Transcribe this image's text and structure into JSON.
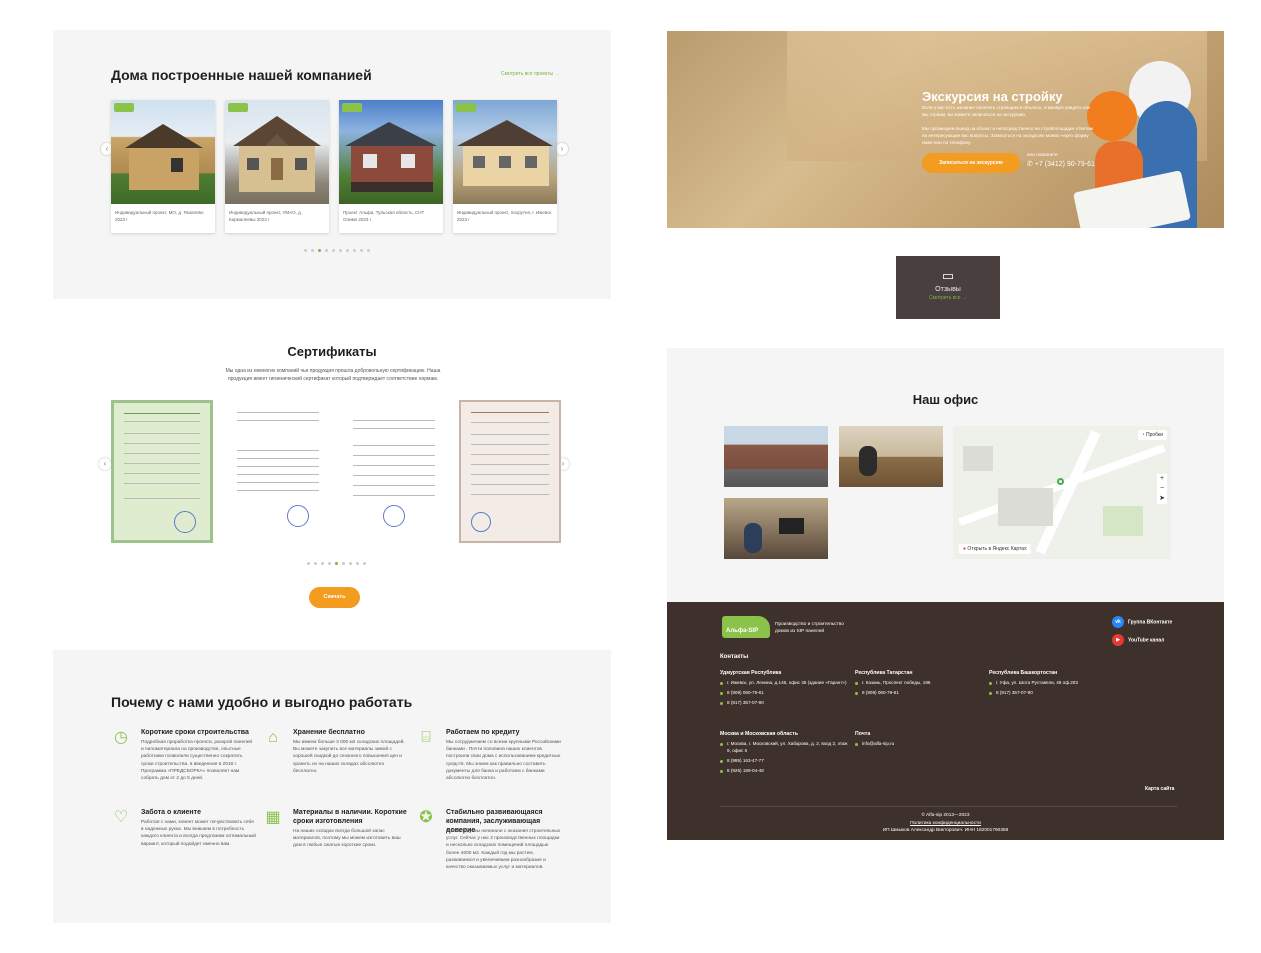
{
  "houses": {
    "title": "Дома построенные нашей компанией",
    "see_all": "Смотреть все проекты →",
    "cards": [
      {
        "caption": "Индивидуальный проект, МО, д. Яковлево 2023 г"
      },
      {
        "caption": "Индивидуальный проект, УМАО, д. Кармалеевы 2023 г"
      },
      {
        "caption": "Проект Альфа, Тульская область, СНТ Олимп 2023 г"
      },
      {
        "caption": "Индивидуальный проект, Хохрутня, г. Ижевск 2023 г"
      }
    ]
  },
  "certs": {
    "title": "Сертификаты",
    "desc": "Мы одна из немногих компаний чья продукция прошла добровольную сертификацию. Наша продукция имеет гигиенический сертификат который подтверждает соответствие нормам.",
    "download": "Скачать"
  },
  "why": {
    "title": "Почему с нами удобно и выгодно работать",
    "features": [
      {
        "title": "Короткие сроки строительства",
        "desc": "Подробная проработка проекта, раскрой панелей и пиломатериала на производстве, опытные работники позволили существенно сократить сроки строительства. в введенная в 2018 г. Программа «ПРЕДСБОРКА» позволяет нам собрать дом от 2 до 5 дней."
      },
      {
        "title": "Хранение бесплатно",
        "desc": "Мы имеем больше 3 000 м2 складских площадей. Вы можете закупить все материалы зимой с хорошей скидкой до сезонного повышения цен и хранить их на наших складах абсолютно бесплатно."
      },
      {
        "title": "Работаем по кредиту",
        "desc": "Мы сотрудничаем со всеми крупными Российскими банками . Почти половина наших клиентов построили свои дома с использованием кредитных средств. Мы знаем как правильно составить документы для банка и работаем с банками абсолютно бесплатно."
      },
      {
        "title": "Забота о клиенте",
        "desc": "Работая с нами, клиент может почувствовать себя в надежных руках. Мы вникаем в потребность каждого клиента и всегда предложим оптимальный вариант, который подойдет именно вам."
      },
      {
        "title": "Материалы в наличии. Короткие сроки изготовления",
        "desc": "На наших складах всегда большой запас материалов, поэтому мы можем изготовить ваш дом в любые сжатые короткие сроки."
      },
      {
        "title": "Стабильно развивающаяся компания, заслуживающая доверие",
        "desc": "В 2008 году мы начинали с оказания строительных услуг. Сейчас у нас 2 производственных площадки и несколько складских помещений площадью более 4000 м2. Каждый год мы растем, развиваемся и увеличиваем разнообразие и качество оказываемых услуг и материалов."
      }
    ],
    "icons": [
      "clock-icon",
      "warehouse-icon",
      "bank-icon",
      "care-icon",
      "materials-icon",
      "trust-icon"
    ]
  },
  "excursion": {
    "title": "Экскурсия на стройку",
    "p1": "Если у вас есть желание посетить строящиеся объекты, и вживую увидеть как мы строим, вы можете записаться на экскурсию.",
    "p2": "Мы организуем выезд на объект и непосредственно на стройплощадке ответим на интересующие вас вопросы. Записаться на экскурсию можно через форму ниже или по телефону.",
    "button": "Записаться на экскурсию",
    "call_label": "или позвоните",
    "phone": "+7 (3412) 90-79-61"
  },
  "reviews": {
    "label": "Отзывы",
    "see_all": "Смотреть все →"
  },
  "office": {
    "title": "Наш офис",
    "map_open": "Открыть в Яндекс Картах",
    "traffic": "Пробки"
  },
  "footer": {
    "logo": "Альфа-SIP",
    "tagline": "Производство и строительство домов из SIP панелей",
    "vk": "Группа ВКонтакте",
    "youtube": "YouTube канал",
    "contacts": "Контакты",
    "regions": [
      {
        "name": "Удмуртская Республика",
        "lines": [
          "г. Ижевск, ул. Ленина, д.146, офис 35 (здание «Гарант»)",
          "8 (909) 060-79-61",
          "8 (917) 357-07-90"
        ]
      },
      {
        "name": "Республика Татарстан",
        "lines": [
          "г. Казань, Проспект победы, 186",
          "8 (909) 060-79-61"
        ]
      },
      {
        "name": "Республика Башкортостан",
        "lines": [
          "г. Уфа, ул. Шота Руставели, 49 оф.203",
          "8 (917) 357-07-90"
        ]
      },
      {
        "name": "Москва и Московская область",
        "lines": [
          "г. Москва, г. Московский, ул. Хабарова, д. 2, вход 2, этаж 9, офис 5",
          "8 (985) 163-47-77",
          "8 (925) 189-04-48"
        ]
      },
      {
        "name": "Почта",
        "lines": [
          "info@alfa-sip.ru"
        ]
      }
    ],
    "sitemap": "Карта сайта",
    "copyright": "© Alfa-sip 2013—2023",
    "privacy": "Политика конфиденциальности",
    "ip": "ИП Шмыков Александр Викторович. ИНН 182001790359"
  }
}
